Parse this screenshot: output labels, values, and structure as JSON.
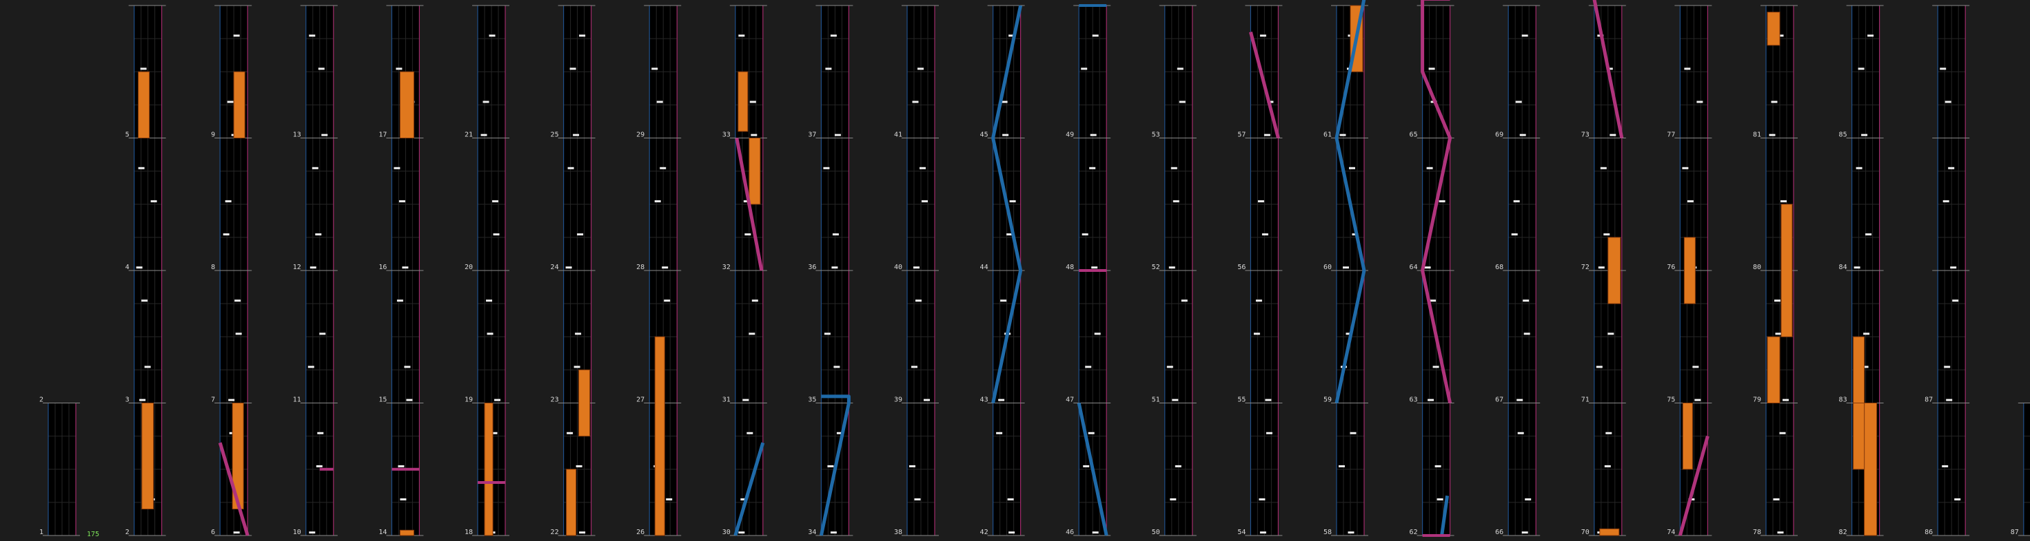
{
  "colors": {
    "background": "#1c1c1c",
    "lane": "#000000",
    "grid": "#262626",
    "left_border": "#1f4f8a",
    "right_border": "#a02a6a",
    "separator": "#8a8a8a",
    "note": "#f0f0f0",
    "hold": "#e0781e",
    "hold_edge": "#8a3c0c",
    "slide_blue": "#1f6aa8",
    "slide_pink": "#b0337c",
    "beat_label": "#d8d8d8",
    "bpm_label": "#7ee35a"
  },
  "bpm_label": "175",
  "columns": [
    {
      "start": 1,
      "beats": 1,
      "hold": [],
      "slides": [],
      "steps": []
    },
    {
      "start": 2,
      "beats": 5,
      "hold": [
        [
          0.2,
          1.0,
          0.3,
          0.7
        ]
      ],
      "slides": [],
      "steps": [
        [
          0.5,
          0.4,
          0.3
        ],
        [
          1.55,
          0.55,
          0.2
        ],
        [
          2.5,
          0.7,
          0.2
        ],
        [
          3.5,
          0.1,
          0.2
        ],
        [
          4.0,
          0.75,
          0.2
        ]
      ]
    },
    {
      "start": 6,
      "beats": 5,
      "hold": [
        [
          0.2,
          1.0,
          0.25,
          0.65
        ],
        [
          3.0,
          4.0,
          0.5,
          0.85
        ]
      ],
      "slides": [
        [
          [
            0.35,
            4.0
          ],
          [
            1.0,
            4.9
          ]
        ],
        "pink"
      ],
      "steps": [
        [
          1.5,
          0.7,
          0.2
        ],
        [
          2.5,
          0.05,
          0.2
        ],
        [
          3.5,
          0.35,
          0.2
        ],
        [
          4.1,
          0.55,
          0.2
        ],
        [
          4.5,
          0.3,
          0.2
        ]
      ]
    },
    {
      "start": 10,
      "beats": 5,
      "hold": [],
      "slides": [],
      "steps": [
        [
          0.0,
          0.7,
          0.2
        ],
        [
          0.7,
          0.55,
          0.2
        ],
        [
          1.3,
          0.2,
          0.2
        ],
        [
          1.8,
          0.2,
          0.2
        ],
        [
          2.3,
          0.2,
          0.2
        ],
        [
          2.8,
          0.55,
          0.2
        ],
        [
          3.0,
          0.2,
          0.2
        ],
        [
          3.6,
          0.2,
          0.2
        ],
        [
          4.3,
          0.55,
          0.2
        ],
        [
          4.8,
          0.3,
          0.2
        ],
        [
          5.0,
          0.1,
          0.2
        ]
      ]
    },
    {
      "start": 14,
      "beats": 5,
      "hold": [
        [
          4.5,
          5.0,
          0.3,
          0.85
        ]
      ],
      "slides": [
        [
          [
            0.0,
            0.5
          ],
          [
            1.0,
            0.5
          ]
        ],
        "pink-flat"
      ],
      "steps": [
        [
          0.0,
          0.3,
          0.2
        ],
        [
          0.5,
          0.5,
          0.2
        ],
        [
          1.5,
          0.4,
          0.2
        ],
        [
          1.75,
          0.7,
          0.2
        ],
        [
          2.5,
          0.3,
          0.2
        ],
        [
          3.0,
          0.1,
          0.2
        ],
        [
          3.25,
          0.75,
          0.2
        ],
        [
          3.75,
          0.35,
          0.2
        ],
        [
          4.0,
          0.35,
          0.2
        ],
        [
          4.0,
          0.15,
          0.2
        ]
      ]
    },
    {
      "start": 18,
      "beats": 5,
      "hold": [
        [
          0.0,
          0.5,
          0.45,
          0.85
        ],
        [
          1.5,
          3.1,
          0.05,
          0.45
        ],
        [
          4.9,
          5.0,
          0.05,
          0.45
        ]
      ],
      "slides": [
        [
          [
            0.0,
            0.05
          ],
          [
            0.1,
            0.2
          ],
          [
            1.0,
            0.8
          ],
          [
            1.0,
            0.9
          ]
        ],
        "pink-flat2"
      ],
      "steps": [
        [
          2.0,
          0.05,
          0.2
        ],
        [
          2.75,
          0.2,
          0.2
        ],
        [
          3.25,
          0.05,
          0.2
        ],
        [
          3.9,
          0.5,
          0.2
        ],
        [
          4.25,
          0.7,
          0.2
        ],
        [
          4.5,
          0.35,
          0.2
        ],
        [
          4.75,
          0.7,
          0.2
        ],
        [
          5.0,
          0.1,
          0.2
        ]
      ]
    },
    {
      "start": 22,
      "beats": 5,
      "hold": [
        [
          0.0,
          0.5,
          0.1,
          0.45
        ],
        [
          0.75,
          1.25,
          0.55,
          0.95
        ],
        [
          4.9,
          5.0,
          0.1,
          0.45
        ]
      ],
      "slides": [],
      "steps": [
        [
          1.5,
          0.3,
          0.2
        ],
        [
          2.0,
          0.25,
          0.2
        ],
        [
          2.5,
          0.7,
          0.2
        ],
        [
          3.0,
          0.3,
          0.2
        ],
        [
          3.5,
          0.5,
          0.2
        ],
        [
          4.0,
          0.25,
          0.2
        ],
        [
          4.5,
          0.25,
          0.2
        ]
      ]
    },
    {
      "start": 26,
      "beats": 5,
      "hold": [
        [
          0.0,
          1.5,
          0.2,
          0.6
        ]
      ],
      "slides": [
        [
          [
            0.0,
            3.0
          ],
          [
            0.2,
            3.75
          ]
        ],
        "pink"
      ],
      "steps": [
        [
          1.25,
          0.5,
          0.2
        ],
        [
          1.25,
          0.75,
          0.2
        ],
        [
          2.0,
          0.15,
          0.2
        ],
        [
          2.5,
          0.5,
          0.2
        ],
        [
          3.0,
          0.8,
          0.2
        ],
        [
          3.6,
          0.5,
          0.2
        ],
        [
          4.0,
          0.2,
          0.2
        ],
        [
          4.75,
          0.25,
          0.2
        ],
        [
          4.0,
          0.95,
          0.05
        ]
      ]
    },
    {
      "start": 30,
      "beats": 5,
      "hold": [
        [
          2.5,
          3.0,
          0.1,
          0.4
        ],
        [
          3.0,
          3.5,
          0.55,
          0.95
        ]
      ],
      "slides": [
        [
          [
            0.0,
            0.0
          ],
          [
            0.45,
            1.0
          ]
        ],
        "blue-top"
      ],
      "steps": [
        [
          1.0,
          0.9,
          0.2
        ],
        [
          1.25,
          0.25,
          0.2
        ],
        [
          1.5,
          0.6,
          0.2
        ],
        [
          2.0,
          0.25,
          0.2
        ],
        [
          3.0,
          0.35,
          0.2
        ],
        [
          3.0,
          0.2,
          0.2
        ],
        [
          4.0,
          0.5,
          0.2
        ],
        [
          4.35,
          0.7,
          0.2
        ],
        [
          4.95,
          0.1,
          0.2
        ]
      ]
    },
    {
      "start": 34,
      "beats": 5,
      "hold": [],
      "slides": [],
      "steps": [
        [
          0.0,
          0.5,
          0.2
        ],
        [
          0.5,
          0.6,
          0.2
        ],
        [
          1.0,
          0.3,
          0.2
        ],
        [
          1.75,
          0.5,
          0.2
        ],
        [
          4.95,
          0.5,
          0.2
        ]
      ]
    },
    {
      "start": 38,
      "beats": 5,
      "hold": [],
      "slides": [],
      "steps": [
        [
          0.0,
          0.3,
          0.2
        ],
        [
          0.75,
          0.5,
          0.2
        ],
        [
          1.25,
          0.2,
          0.2
        ],
        [
          1.5,
          0.5,
          0.2
        ],
        [
          2.0,
          0.1,
          0.2
        ],
        [
          2.5,
          0.4,
          0.2
        ],
        [
          3.0,
          0.5,
          0.2
        ],
        [
          3.75,
          0.2,
          0.2
        ],
        [
          4.0,
          0.2,
          0.2
        ],
        [
          4.5,
          0.4,
          0.2
        ],
        [
          4.95,
          0.7,
          0.2
        ]
      ]
    },
    {
      "start": 42,
      "beats": 5,
      "hold": [],
      "slides": [],
      "steps": [
        [
          0.0,
          0.3,
          0.2
        ],
        [
          0.5,
          0.5,
          0.2
        ],
        [
          0.75,
          0.75,
          0.2
        ],
        [
          2.0,
          0.1,
          0.2
        ],
        [
          4.95,
          0.5,
          0.2
        ]
      ]
    },
    {
      "start": 46,
      "beats": 5,
      "hold": [],
      "slides": [],
      "steps": [
        [
          0.0,
          0.15,
          0.2
        ],
        [
          0.25,
          0.3,
          0.2
        ],
        [
          0.55,
          0.4,
          0.2
        ],
        [
          1.0,
          0.1,
          0.2
        ],
        [
          1.5,
          0.15,
          0.2
        ],
        [
          2.0,
          0.15,
          0.2
        ],
        [
          2.5,
          0.1,
          0.2
        ],
        [
          3.0,
          0.15,
          0.2
        ],
        [
          3.5,
          0.25,
          0.2
        ],
        [
          3.75,
          0.25,
          0.2
        ],
        [
          4.0,
          0.2,
          0.2
        ],
        [
          4.5,
          0.15,
          0.2
        ],
        [
          5.0,
          0.2,
          0.2
        ]
      ]
    },
    {
      "start": 50,
      "beats": 5,
      "hold": [],
      "slides": [],
      "steps": [
        [
          0.0,
          0.1,
          0.2
        ],
        [
          0.25,
          0.3,
          0.2
        ],
        [
          0.5,
          0.5,
          0.2
        ],
        [
          1.0,
          0.2,
          0.2
        ],
        [
          1.5,
          0.3,
          0.2
        ],
        [
          2.0,
          0.4,
          0.2
        ],
        [
          2.5,
          0.25,
          0.2
        ],
        [
          3.0,
          0.2,
          0.2
        ],
        [
          3.5,
          0.3,
          0.2
        ],
        [
          3.75,
          0.05,
          0.2
        ],
        [
          4.0,
          0.4,
          0.2
        ],
        [
          4.5,
          0.2,
          0.2
        ],
        [
          4.95,
          0.15,
          0.2
        ]
      ]
    },
    {
      "start": 54,
      "beats": 5,
      "hold": [
        [
          3.75,
          4.25,
          0.55,
          0.95
        ]
      ],
      "slides": [
        [
          [
            1.0,
            1.0
          ],
          [
            0.0,
            0.35
          ]
        ],
        "pink"
      ],
      "steps": [
        [
          0.0,
          0.25,
          0.2
        ],
        [
          0.25,
          0.3,
          0.2
        ],
        [
          0.5,
          0.25,
          0.2
        ],
        [
          1.0,
          0.25,
          0.2
        ],
        [
          1.5,
          0.2,
          0.2
        ],
        [
          2.0,
          0.25,
          0.2
        ],
        [
          2.5,
          0.2,
          0.2
        ],
        [
          3.0,
          0.25,
          0.2
        ],
        [
          3.5,
          0.25,
          0.2
        ],
        [
          4.0,
          0.2,
          0.2
        ],
        [
          4.5,
          0.2,
          0.2
        ],
        [
          4.95,
          0.2,
          0.2
        ]
      ]
    },
    {
      "start": 58,
      "beats": 5,
      "hold": [],
      "slides": [],
      "steps": [
        [
          0.0,
          0.1,
          0.2
        ],
        [
          0.5,
          0.25,
          0.2
        ],
        [
          1.0,
          0.2,
          0.2
        ],
        [
          1.5,
          0.25,
          0.2
        ],
        [
          2.0,
          0.3,
          0.2
        ],
        [
          2.5,
          0.25,
          0.2
        ],
        [
          3.0,
          0.3,
          0.2
        ],
        [
          3.5,
          0.2,
          0.2
        ],
        [
          4.0,
          0.3,
          0.2
        ],
        [
          4.5,
          0.25,
          0.2
        ],
        [
          4.95,
          0.2,
          0.2
        ]
      ]
    },
    {
      "start": 62,
      "beats": 5,
      "hold": [],
      "slides": [],
      "steps": [
        [
          0.0,
          0.2,
          0.2
        ],
        [
          0.5,
          0.25,
          0.2
        ],
        [
          0.75,
          0.25,
          0.2
        ],
        [
          1.0,
          0.25,
          0.2
        ],
        [
          1.5,
          0.3,
          0.2
        ],
        [
          2.0,
          0.2,
          0.2
        ],
        [
          2.5,
          0.35,
          0.2
        ],
        [
          3.0,
          0.3,
          0.2
        ],
        [
          3.5,
          0.25,
          0.2
        ],
        [
          4.0,
          0.2,
          0.2
        ],
        [
          4.5,
          0.2,
          0.2
        ],
        [
          5.0,
          0.2,
          0.2
        ]
      ]
    }
  ]
}
